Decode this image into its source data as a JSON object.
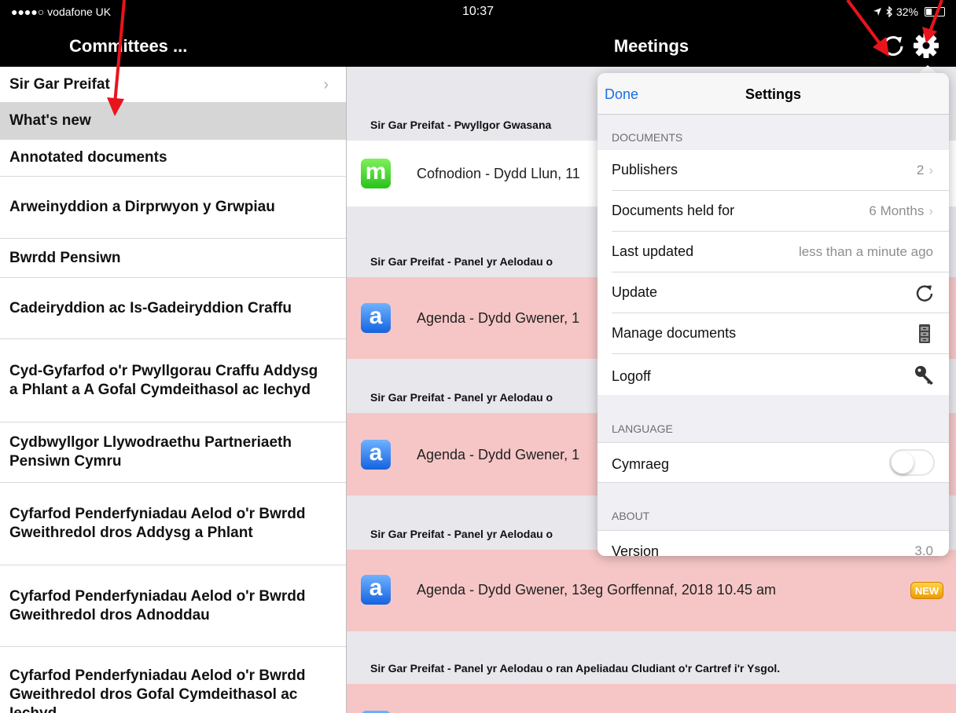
{
  "status_bar": {
    "carrier": "●●●●○ vodafone UK",
    "time": "10:37",
    "battery": "32%"
  },
  "nav": {
    "left_title": "Committees ...",
    "title": "Meetings",
    "icons": [
      "refresh-icon",
      "gear-icon"
    ]
  },
  "sidebar": {
    "items": [
      {
        "label": "Sir Gar Preifat",
        "chevron": "›"
      },
      {
        "label": "What's new"
      },
      {
        "label": "Annotated documents"
      },
      {
        "label": "Arweinyddion a Dirprwyon y Grwpiau"
      },
      {
        "label": "Bwrdd Pensiwn"
      },
      {
        "label": "Cadeiryddion ac Is-Gadeiryddion Craffu"
      },
      {
        "label": "Cyd-Gyfarfod o'r Pwyllgorau Craffu Addysg a Phlant a A Gofal Cymdeithasol ac Iechyd"
      },
      {
        "label": "Cydbwyllgor Llywodraethu Partneriaeth Pensiwn Cymru"
      },
      {
        "label": "Cyfarfod Penderfyniadau Aelod o'r Bwrdd Gweithredol dros Addysg a Phlant"
      },
      {
        "label": "Cyfarfod Penderfyniadau Aelod o'r Bwrdd Gweithredol dros Adnoddau"
      },
      {
        "label": "Cyfarfod Penderfyniadau Aelod o'r Bwrdd Gweithredol dros Gofal Cymdeithasol ac Iechyd"
      }
    ]
  },
  "meetings": {
    "sections": [
      {
        "header": "Sir Gar Preifat - Pwyllgor Gwasana",
        "doc": {
          "icon": "m",
          "title": "Cofnodion - Dydd Llun, 11"
        }
      },
      {
        "header": "Sir Gar Preifat - Panel yr Aelodau o",
        "doc": {
          "icon": "a",
          "title": "Agenda - Dydd Gwener, 1"
        }
      },
      {
        "header": "Sir Gar Preifat - Panel yr Aelodau o",
        "doc": {
          "icon": "a",
          "title": "Agenda - Dydd Gwener, 1"
        }
      },
      {
        "header": "Sir Gar Preifat - Panel yr Aelodau o",
        "doc": {
          "icon": "a",
          "title": "Agenda - Dydd Gwener, 13eg Gorffennaf, 2018 10.45 am",
          "badge": "NEW"
        }
      },
      {
        "header": "Sir Gar Preifat - Panel yr Aelodau o ran Apeliadau Cludiant o'r Cartref i'r Ysgol.",
        "doc": {
          "icon": "a",
          "title": ""
        }
      }
    ]
  },
  "settings": {
    "done_label": "Done",
    "title": "Settings",
    "documents_label": "DOCUMENTS",
    "publishers_label": "Publishers",
    "publishers_value": "2",
    "held_label": "Documents held for",
    "held_value": "6 Months",
    "updated_label": "Last updated",
    "updated_value": "less than a minute ago",
    "update_label": "Update",
    "manage_label": "Manage documents",
    "logoff_label": "Logoff",
    "language_label": "LANGUAGE",
    "cymraeg_label": "Cymraeg",
    "cymraeg_on": false,
    "about_label": "ABOUT",
    "version_label": "Version",
    "version_value": "3.0"
  },
  "colors": {
    "accent": "#1a6fe0",
    "annotation_arrow": "#e8141c",
    "pink_row": "#f6c6c6",
    "new_badge": "#f2a90a"
  }
}
